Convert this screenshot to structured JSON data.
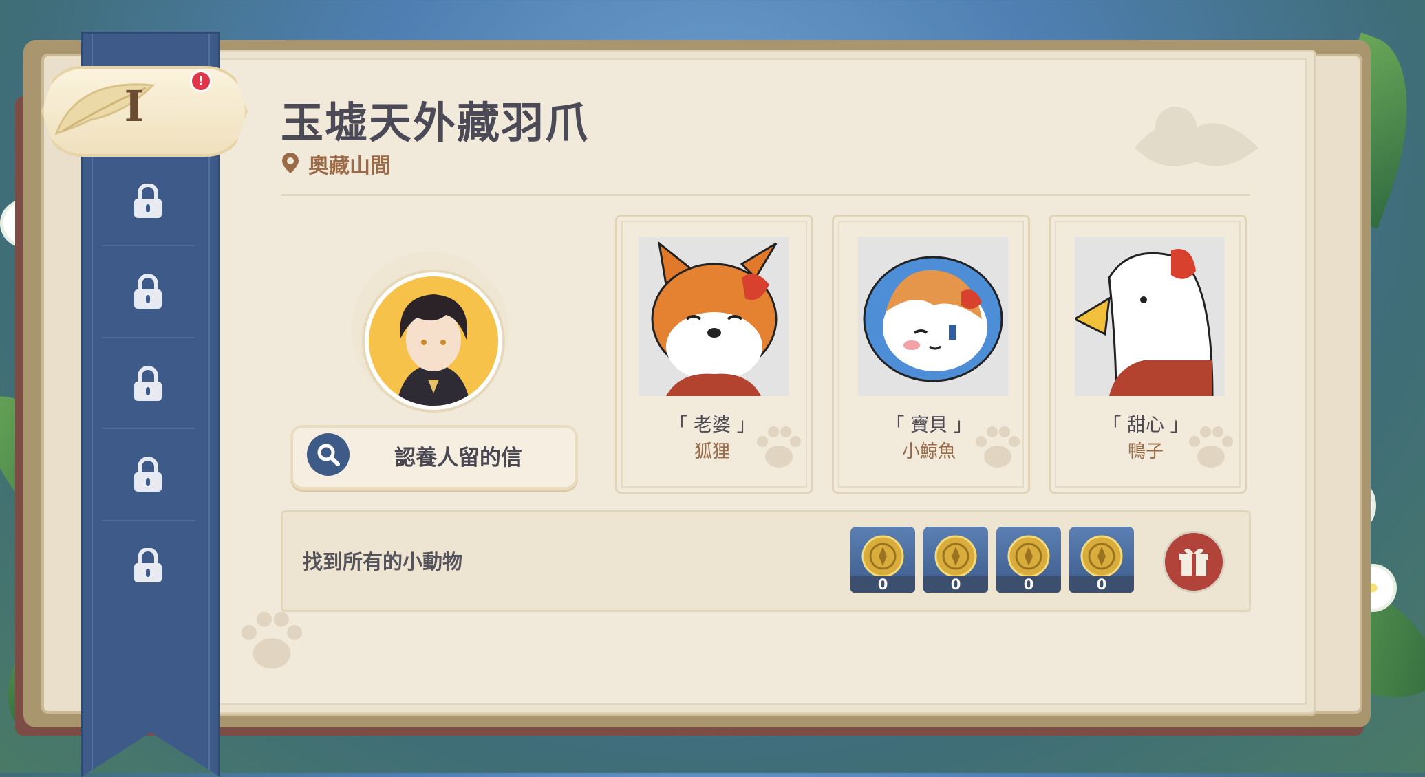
{
  "chapter": {
    "numeral": "I",
    "alert": "!"
  },
  "header": {
    "title": "玉墟天外藏羽爪",
    "location": "奧藏山間"
  },
  "adopter": {
    "letter_button_label": "認養人留的信"
  },
  "animals": [
    {
      "nickname": "「 老婆 」",
      "species": "狐狸"
    },
    {
      "nickname": "「 寶貝 」",
      "species": "小鯨魚"
    },
    {
      "nickname": "「 甜心 」",
      "species": "鴨子"
    }
  ],
  "task": {
    "label": "找到所有的小動物",
    "rewards": [
      {
        "icon": "mora-coin-icon",
        "count": "0"
      },
      {
        "icon": "mora-coin-icon",
        "count": "0"
      },
      {
        "icon": "mora-coin-icon",
        "count": "0"
      },
      {
        "icon": "mora-coin-icon",
        "count": "0"
      }
    ]
  },
  "sidebar": {
    "locked_chapters": 5
  },
  "colors": {
    "ribbon": "#3d5a89",
    "page": "#f1eadb",
    "title": "#4c4a56",
    "accent_brown": "#9a6b48",
    "gift": "#b2433a"
  }
}
